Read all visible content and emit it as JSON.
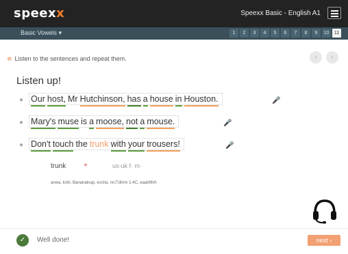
{
  "header": {
    "brand_main": "speex",
    "brand_accent": "x",
    "course": "Speexx Basic - English A1"
  },
  "nav": {
    "section": "Basic Vowels ▾",
    "pages": [
      "1",
      "2",
      "3",
      "4",
      "5",
      "6",
      "7",
      "8",
      "9",
      "10",
      "11"
    ],
    "active_page": "11"
  },
  "instruction": "Listen to the sentences and repeat them.",
  "nav_arrows": [
    "‹",
    "›"
  ],
  "heading": "Listen up!",
  "sentences": [
    {
      "words": [
        "Our",
        "host,",
        "Mr",
        "Hutchinson,",
        "has",
        "a",
        "house",
        "in",
        "Houston."
      ]
    },
    {
      "words": [
        "Mary's",
        "muse",
        "is",
        "a",
        "moose,",
        "not",
        "a",
        "mouse."
      ]
    },
    {
      "words": [
        "Don't",
        "touch",
        "the",
        "trunk",
        "with",
        "your",
        "trousers!"
      ]
    }
  ],
  "detail": {
    "word": "trunk",
    "plus": "+",
    "variant": "us-uk  f·  m·",
    "phonetic": "anwa, knih, Bananalnap, evcha, nrcTdhrm 1-4C, eaalrtlfvh"
  },
  "footer": {
    "status": "Well done!",
    "next_label": "next ›"
  },
  "colors": {
    "accent": "#f07d2a",
    "navbar": "#3a4f5a",
    "underline_green": "#5a9a3c",
    "underline_orange": "#f0a05a"
  }
}
